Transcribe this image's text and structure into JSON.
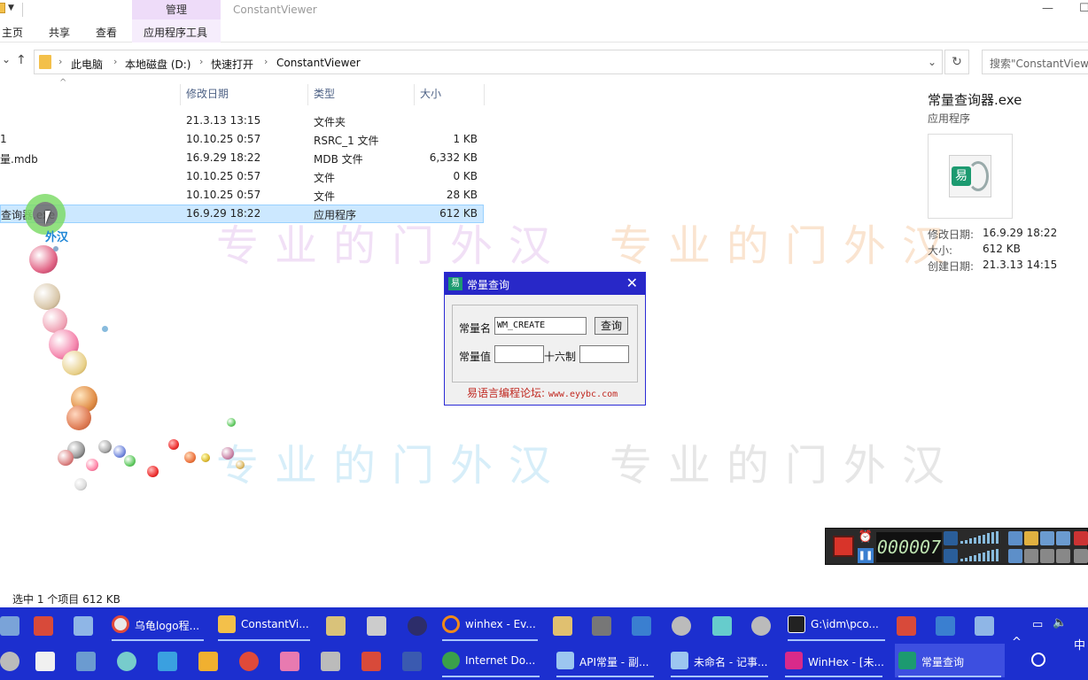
{
  "window": {
    "title": "ConstantViewer",
    "context_tab_group": "管理",
    "ribbon_tabs": [
      "主页",
      "共享",
      "查看",
      "应用程序工具"
    ],
    "minimize": "—",
    "maximize": "☐"
  },
  "address": {
    "crumbs": [
      "此电脑",
      "本地磁盘 (D:)",
      "快速打开",
      "ConstantViewer"
    ],
    "search_placeholder": "搜索\"ConstantViewer\"",
    "refresh_glyph": "↻",
    "dropdown_glyph": "⌄",
    "back_glyph": "⌄",
    "up_glyph": "↑",
    "crumb_sep": "›"
  },
  "file_list": {
    "columns": [
      "修改日期",
      "类型",
      "大小"
    ],
    "sort_glyph": "^",
    "rows": [
      {
        "name": "",
        "date": "21.3.13 13:15",
        "type": "文件夹",
        "size": ""
      },
      {
        "name": "1",
        "date": "10.10.25 0:57",
        "type": "RSRC_1 文件",
        "size": "1 KB"
      },
      {
        "name": "量.mdb",
        "date": "16.9.29 18:22",
        "type": "MDB 文件",
        "size": "6,332 KB"
      },
      {
        "name": "",
        "date": "10.10.25 0:57",
        "type": "文件",
        "size": "0 KB"
      },
      {
        "name": "",
        "date": "10.10.25 0:57",
        "type": "文件",
        "size": "28 KB"
      },
      {
        "name": "查询器.exe",
        "date": "16.9.29 18:22",
        "type": "应用程序",
        "size": "612 KB"
      }
    ]
  },
  "details": {
    "title": "常量查询器.exe",
    "subtitle": "应用程序",
    "props": [
      {
        "label": "修改日期:",
        "value": "16.9.29 18:22"
      },
      {
        "label": "大小:",
        "value": "612 KB"
      },
      {
        "label": "创建日期:",
        "value": "21.3.13 14:15"
      }
    ]
  },
  "cursor_text": "外汉",
  "watermark": [
    "专业的门外汉",
    "专业的门外汉"
  ],
  "dialog": {
    "title": "常量查询",
    "close": "✕",
    "name_label": "常量名",
    "name_value": "WM_CREATE",
    "query_button": "查询",
    "value_label": "常量值",
    "value_value": "",
    "hex_label": "十六制",
    "hex_value": "",
    "footer_text": "易语言编程论坛:",
    "footer_url": "www.eyybc.com",
    "icon_glyph": "易"
  },
  "recorder": {
    "time": "000007",
    "clock_glyph": "⏰",
    "pause_glyph": "❚❚"
  },
  "status": {
    "text": "选中 1 个项目  612 KB"
  },
  "taskbar": {
    "row1": [
      {
        "label": "乌龟logo程..."
      },
      {
        "label": "ConstantVi..."
      },
      {
        "label": "winhex - Ev..."
      },
      {
        "label": "G:\\idm\\pco..."
      }
    ],
    "row2": [
      {
        "label": "Internet Do..."
      },
      {
        "label": "API常量 - 副..."
      },
      {
        "label": "未命名 - 记事..."
      },
      {
        "label": "WinHex - [未..."
      },
      {
        "label": "常量查询"
      }
    ],
    "tray_ime": "中",
    "tray_caret": "^",
    "tray_sound": "🔈"
  },
  "colors": {
    "taskbar": "#1c2fcf",
    "dialog_title": "#2828c8",
    "selection": "#cce8ff",
    "context_tab": "#eedcf9",
    "footer_red": "#c0271f"
  }
}
